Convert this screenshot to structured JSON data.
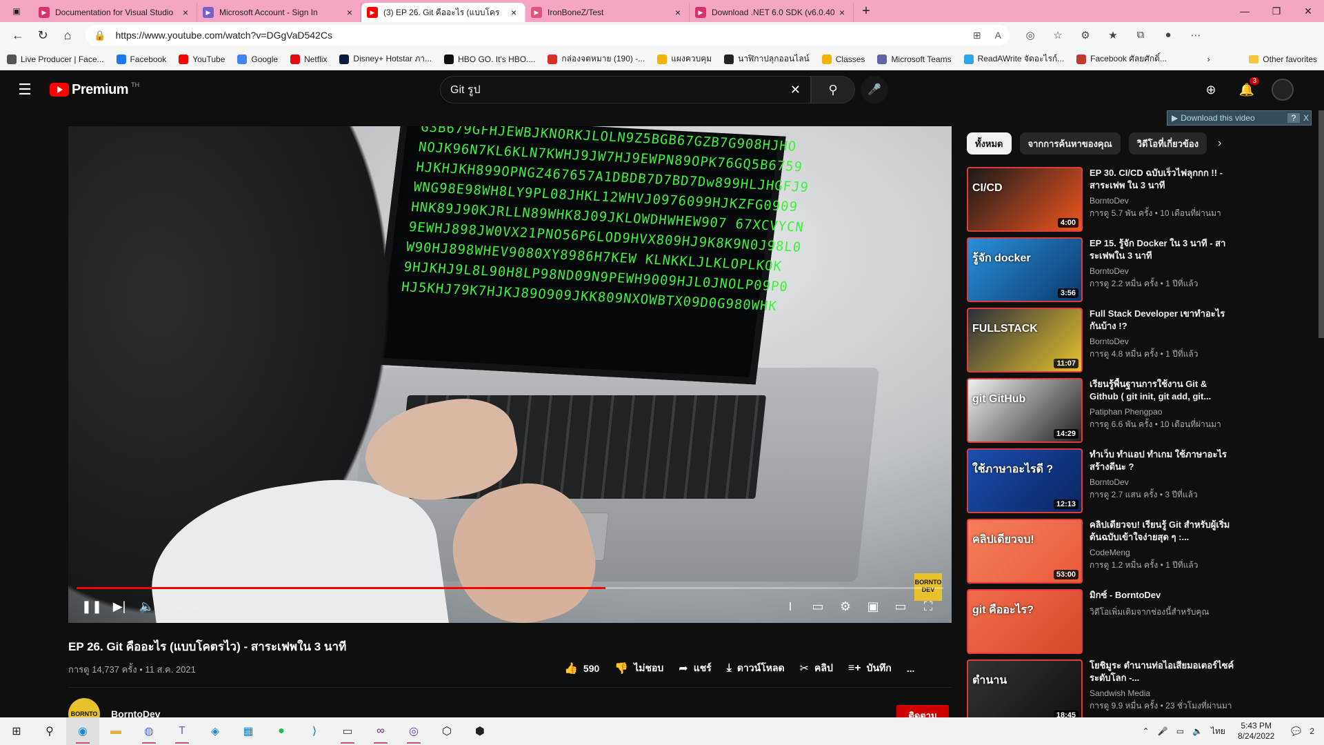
{
  "browser": {
    "tabs": [
      {
        "title": "Documentation for Visual Studio",
        "icon": "doc-icon",
        "color": "#d6336c"
      },
      {
        "title": "Microsoft Account - Sign In",
        "icon": "vs-icon",
        "color": "#7b5fc8"
      },
      {
        "title": "(3) EP 26. Git คืออะไร (แบบโคร",
        "icon": "youtube-icon",
        "color": "#ff0000",
        "active": true
      },
      {
        "title": "IronBoneZ/Test",
        "icon": "github-icon",
        "color": "#e0557f"
      },
      {
        "title": "Download .NET 6.0 SDK (v6.0.40",
        "icon": "doc-icon",
        "color": "#d6336c"
      }
    ],
    "url": "https://www.youtube.com/watch?v=DGgVaD542Cs",
    "bookmarks": [
      {
        "label": "Live Producer | Face...",
        "color": "#555555"
      },
      {
        "label": "Facebook",
        "color": "#1877f2"
      },
      {
        "label": "YouTube",
        "color": "#ff0000"
      },
      {
        "label": "Google",
        "color": "#4285f4"
      },
      {
        "label": "Netflix",
        "color": "#e50914"
      },
      {
        "label": "Disney+ Hotstar ภา...",
        "color": "#0b1a3e"
      },
      {
        "label": "HBO GO. It's HBO....",
        "color": "#111111"
      },
      {
        "label": "กล่องจดหมาย (190) -...",
        "color": "#d93025"
      },
      {
        "label": "แผงควบคุม",
        "color": "#f4b400"
      },
      {
        "label": "นาฬิกาปลุกออนไลน์",
        "color": "#222222"
      },
      {
        "label": "Classes",
        "color": "#f4b400"
      },
      {
        "label": "Microsoft Teams",
        "color": "#6264a7"
      },
      {
        "label": "ReadAWrite จัดอะไรก์...",
        "color": "#2fa4e7"
      },
      {
        "label": "Facebook ศัลยศักดิ์...",
        "color": "#c0392b"
      }
    ],
    "other_favorites": "Other favorites"
  },
  "youtube": {
    "logo_text": "Premium",
    "country_code": "TH",
    "search_query": "Git รูป",
    "notification_count": "3",
    "download_bar": "Download this video",
    "download_help": "?",
    "download_close": "X"
  },
  "video": {
    "title": "EP 26. Git คืออะไร (แบบโคตรไว) - สาระเฟพใน 3 นาที",
    "meta": "การดู 14,737 ครั้ง • 11 ส.ค. 2021",
    "current_time": "2:47",
    "duration": "4:32",
    "time_display": "2:47 / 4:32",
    "progress": 0.61,
    "brand_watermark": "BORNTO DEV",
    "screen_code": [
      "G3B679GFHJEWBJKNORKJLOLN9Z5BGB67GZB7G908HJHO",
      "NOJK96N7KL6KLN7KWHJ9JW7HJ9EWPN89OPK76GQ5B6759",
      "HJKHJKH899OPNGZ467657A1DBDB7D7BD7Dw899HLJHGFJ9",
      "WNG98E98WH8LY9PL08JHKL12WHVJ0976099HJKZFG0909",
      "HNK89J90KJRLLN89WHK8J09JKLOWDHWHEW907 67XCVYCN",
      "9EWHJ898JW0VX21PNO56P6LOD9HVX809HJ9K8K9N0J98L0",
      "W90HJ898WHEV9080XY8986H7KEW KLNKKLJLKLOPLKOK",
      "9HJKHJ9L8L90H8LP98ND09N9PEWH9009HJL0JNOLP09P0",
      "HJ5KHJ79K7HJKJ89O909JKK809NXOWBTX09D0G980WHK"
    ],
    "actions": {
      "like_count": "590",
      "dislike": "ไม่ชอบ",
      "share": "แชร์",
      "download": "ดาวน์โหลด",
      "clip": "คลิป",
      "save": "บันทึก",
      "more": "..."
    },
    "channel": {
      "name": "BorntoDev",
      "avatar_text": "BORNTO",
      "subscribe": "ติดตาม"
    }
  },
  "chips": [
    "ทั้งหมด",
    "จากการค้นหาของคุณ",
    "วิดีโอที่เกี่ยวข้อง"
  ],
  "recommendations": [
    {
      "title": "EP 30. CI/CD ฉบับเร็วไฟลุกกก !! - สาระเฟพ ใน 3 นาที",
      "channel": "BorntoDev",
      "meta": "การดู 5.7 พัน ครั้ง • 10 เดือนที่ผ่านมา",
      "duration": "4:00",
      "thumb_text": "CI/CD",
      "colors": [
        "#1a1a1a",
        "#f0551e"
      ]
    },
    {
      "title": "EP 15. รู้จัก Docker ใน 3 นาที - สาระเฟพใน 3 นาที",
      "channel": "BorntoDev",
      "meta": "การดู 2.2 หมื่น ครั้ง • 1 ปีที่แล้ว",
      "duration": "3:56",
      "thumb_text": "รู้จัก docker",
      "colors": [
        "#2a8fd8",
        "#0a3a6e"
      ]
    },
    {
      "title": "Full Stack Developer เขาทำอะไรกันบ้าง !?",
      "channel": "BorntoDev",
      "meta": "การดู 4.8 หมื่น ครั้ง • 1 ปีที่แล้ว",
      "duration": "11:07",
      "thumb_text": "FULLSTACK",
      "colors": [
        "#2a2f3a",
        "#e7c22d"
      ]
    },
    {
      "title": "เรียนรู้พื้นฐานการใช้งาน Git & Github ( git init, git add, git...",
      "channel": "Patiphan Phengpao",
      "meta": "การดู 6.6 พัน ครั้ง • 10 เดือนที่ผ่านมา",
      "duration": "14:29",
      "thumb_text": "git GitHub",
      "colors": [
        "#f0f0f0",
        "#222222"
      ]
    },
    {
      "title": "ทำเว็บ ทำแอป ทำเกม ใช้ภาษาอะไรสร้างดีนะ ?",
      "channel": "BorntoDev",
      "meta": "การดู 2.7 แสน ครั้ง • 3 ปีที่แล้ว",
      "duration": "12:13",
      "thumb_text": "ใช้ภาษาอะไรดี ?",
      "colors": [
        "#1b4fb0",
        "#0a2560"
      ]
    },
    {
      "title": "คลิปเดียวจบ! เรียนรู้ Git สำหรับผู้เริ่มต้นฉบับเข้าใจง่ายสุด ๆ :...",
      "channel": "CodeMeng",
      "meta": "การดู 1.2 หมื่น ครั้ง • 1 ปีที่แล้ว",
      "duration": "53:00",
      "thumb_text": "คลิปเดียวจบ!",
      "colors": [
        "#f57f5b",
        "#e85a3a"
      ]
    },
    {
      "title": "มิกซ์ - BorntoDev",
      "channel": "วิดีโอเพิ่มเติมจากช่องนี้สำหรับคุณ",
      "meta": "",
      "duration": "",
      "thumb_text": "git คืออะไร?",
      "colors": [
        "#f06a4a",
        "#d84a2a"
      ]
    },
    {
      "title": "โยชิมูระ ตำนานท่อไอเสียมอเตอร์ไซค์ระดับโลก -...",
      "channel": "Sandwish Media",
      "meta": "การดู 9.9 หมื่น ครั้ง • 23 ชั่วโมงที่ผ่านมา",
      "duration": "18:45",
      "thumb_text": "ตำนาน",
      "colors": [
        "#333333",
        "#111111"
      ]
    }
  ],
  "taskbar": {
    "language": "ไทย",
    "time": "5:43 PM",
    "date": "8/24/2022",
    "notif_count": "2"
  }
}
